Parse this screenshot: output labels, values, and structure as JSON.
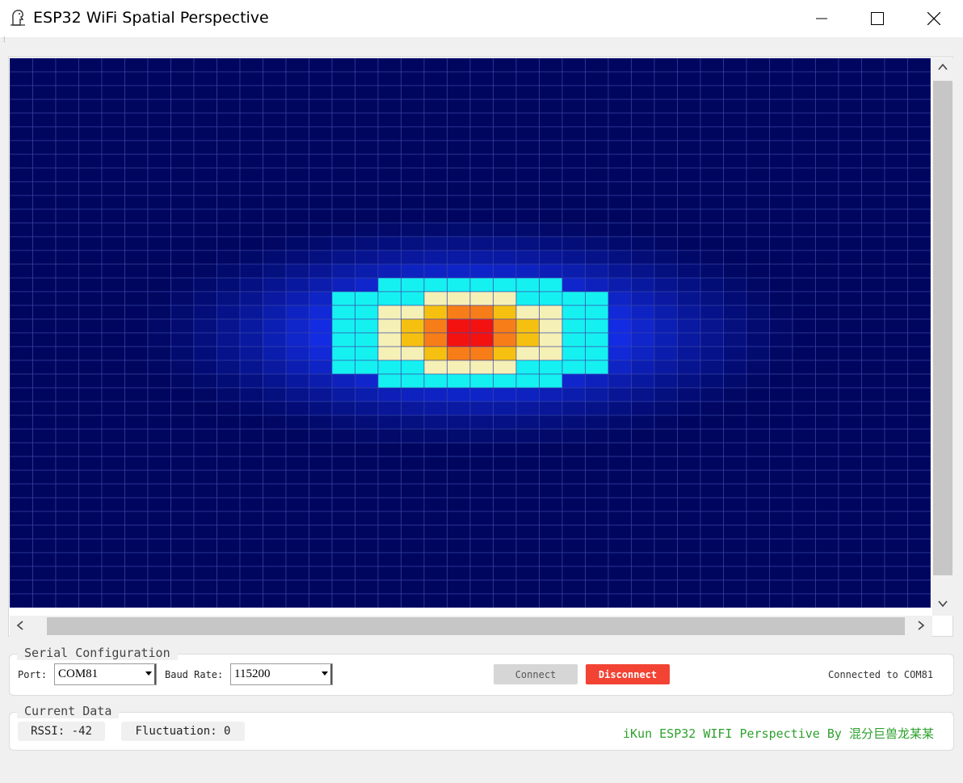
{
  "window": {
    "title": "ESP32 WiFi Spatial Perspective",
    "minimize_icon": "minimize-icon",
    "maximize_icon": "maximize-icon",
    "close_icon": "close-icon",
    "app_icon": "app-logo-icon"
  },
  "heatmap": {
    "colors": {
      "background": "#00065e",
      "grid": "#3a47a8",
      "cyan": "#15f1f1",
      "light_yellow": "#f5f0b5",
      "yellow": "#f6c010",
      "orange": "#f77d18",
      "red": "#f41210"
    },
    "peak_row": 20,
    "peak_col": 20,
    "grid_rows": 40,
    "grid_cols": 40
  },
  "serial_config": {
    "title": "Serial Configuration",
    "port_label": "Port:",
    "port_value": "COM81",
    "baud_label": "Baud Rate:",
    "baud_value": "115200",
    "connect_label": "Connect",
    "disconnect_label": "Disconnect",
    "status_text": "Connected to COM81",
    "colors": {
      "disconnect": "#f24334",
      "connect_disabled": "#d6d6d6"
    }
  },
  "current_data": {
    "title": "Current Data",
    "rssi_text": "RSSI: -42",
    "fluctuation_text": "Fluctuation: 0",
    "credit_text": "iKun ESP32 WIFI Perspective By 混分巨兽龙某某",
    "colors": {
      "credit": "#2ea12e"
    }
  }
}
